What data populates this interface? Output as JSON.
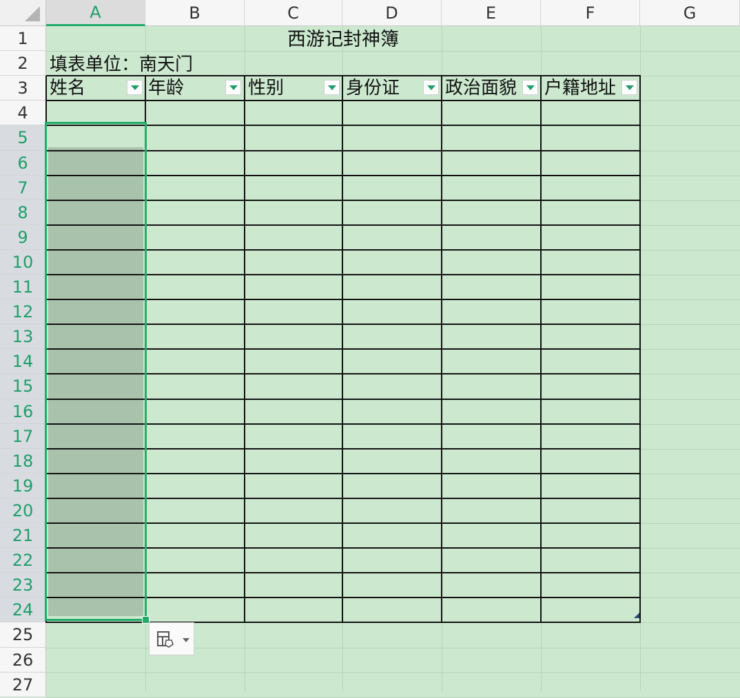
{
  "columns": [
    "A",
    "B",
    "C",
    "D",
    "E",
    "F",
    "G"
  ],
  "rows": [
    "1",
    "2",
    "3",
    "4",
    "5",
    "6",
    "7",
    "8",
    "9",
    "10",
    "11",
    "12",
    "13",
    "14",
    "15",
    "16",
    "17",
    "18",
    "19",
    "20",
    "21",
    "22",
    "23",
    "24",
    "25",
    "26",
    "27"
  ],
  "sheet": {
    "title": "西游记封神簿",
    "unit_label": "填表单位：南天门",
    "headers": [
      "姓名",
      "年龄",
      "性别",
      "身份证",
      "政治面貌",
      "户籍地址"
    ]
  },
  "selection": {
    "range": "A5:A24",
    "active_cell": "A5"
  },
  "colors": {
    "sheet_background": "#cce8cf",
    "selection_accent": "#1fae6a",
    "selection_fill": "#a9c2ab"
  },
  "icons": {
    "quick_analysis": "paste-options-icon",
    "filter": "filter-dropdown-icon"
  }
}
